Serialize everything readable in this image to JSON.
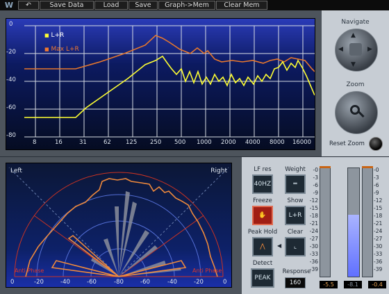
{
  "toolbar": {
    "logo": "W",
    "undo_icon": "undo-icon",
    "buttons": [
      "Save Data",
      "Load",
      "Save",
      "Graph->Mem",
      "Clear Mem"
    ]
  },
  "spectrum": {
    "legend": [
      {
        "label": "L+R",
        "color": "#ffff33"
      },
      {
        "label": "Max L+R",
        "color": "#f07830"
      }
    ],
    "y_ticks": [
      "0",
      "-20",
      "-40",
      "-60",
      "-80"
    ],
    "x_ticks": [
      "8",
      "16",
      "31",
      "62",
      "125",
      "250",
      "500",
      "1000",
      "2000",
      "4000",
      "8000",
      "16000"
    ]
  },
  "navigate": {
    "title": "Navigate"
  },
  "zoom": {
    "title": "Zoom",
    "reset_label": "Reset Zoom"
  },
  "phase": {
    "left_label": "Left",
    "right_label": "Right",
    "anti_phase_left": "Anti Phase",
    "anti_phase_right": "Anti Phase",
    "x_ticks": [
      "0",
      "-20",
      "-40",
      "-60",
      "-80",
      "-60",
      "-40",
      "-20",
      "0"
    ]
  },
  "controls": {
    "lf_res": {
      "label": "LF res",
      "value": "40HZ"
    },
    "weight": {
      "label": "Weight"
    },
    "freeze": {
      "label": "Freeze"
    },
    "show": {
      "label": "Show",
      "value": "L+R"
    },
    "peak_hold": {
      "label": "Peak Hold"
    },
    "clear": {
      "label": "Clear"
    },
    "detect": {
      "label": "Detect",
      "value": "PEAK"
    },
    "response": {
      "label": "Response",
      "value": "160"
    }
  },
  "meters": {
    "scale": [
      "-0",
      "-3",
      "-6",
      "-9",
      "-12",
      "-15",
      "-18",
      "-21",
      "-24",
      "-27",
      "-30",
      "-33",
      "-36",
      "-39"
    ],
    "left_value": "-5.5",
    "center_value": "-8.1",
    "right_value": "-0.4",
    "center_level_db": -8.1
  }
}
